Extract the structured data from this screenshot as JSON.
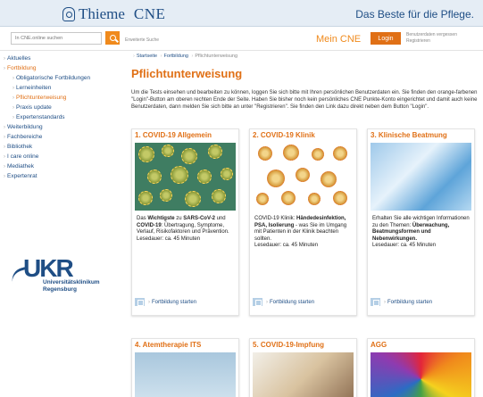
{
  "header": {
    "brand": "Thieme",
    "brand_suffix": "CNE",
    "slogan": "Das Beste für die Pflege."
  },
  "toolbar": {
    "search_placeholder": "In CNE.online suchen",
    "advanced_search": "Erweiterte Suche",
    "mein_cne": "Mein CNE",
    "login_label": "Login",
    "forgot_credentials": "Benutzerdaten vergessen",
    "register": "Registrieren"
  },
  "sidebar": {
    "items": [
      {
        "label": "Aktuelles"
      },
      {
        "label": "Fortbildung"
      },
      {
        "label": "Obligatorische Fortbildungen"
      },
      {
        "label": "Lerneinheiten"
      },
      {
        "label": "Pflichtunterweisung"
      },
      {
        "label": "Praxis update"
      },
      {
        "label": "Expertenstandards"
      },
      {
        "label": "Weiterbildung"
      },
      {
        "label": "Fachbereiche"
      },
      {
        "label": "Bibliothek"
      },
      {
        "label": "I care online"
      },
      {
        "label": "Mediathek"
      },
      {
        "label": "Expertenrat"
      }
    ],
    "logo_mark": "UKR",
    "logo_line1": "Universitätsklinikum",
    "logo_line2": "Regensburg"
  },
  "breadcrumb": [
    "Startseite",
    "Fortbildung",
    "Pflichtunterweisung"
  ],
  "page": {
    "title": "Pflichtunterweisung",
    "intro": "Um die Tests einsehen und bearbeiten zu können, loggen Sie sich bitte mit Ihren persönlichen Benutzerdaten ein. Sie finden den orange-farbenen \"Login\"-Button am oberen rechten Ende der Seite. Haben Sie bisher noch kein persönliches CNE Punkte-Konto eingerichtet und damit auch keine Benutzerdaten, dann melden Sie sich bitte an unter \"Registrieren\". Sie finden den Link dazu direkt neben dem Button \"Login\"."
  },
  "cards": [
    {
      "title": "1. COVID-19 Allgemein",
      "text_pre": "Das ",
      "text_b1": "Wichtigste",
      "text_mid1": " zu ",
      "text_b2": "SARS-CoV-2",
      "text_mid2": " und ",
      "text_b3": "COVID-19",
      "text_post": ": Übertragung, Symptome, Verlauf, Risikofaktoren und Prävention.",
      "duration": "Lesedauer: ca. 45 Minuten",
      "action": "Fortbildung starten"
    },
    {
      "title": "2. COVID-19 Klinik",
      "text_pre": "COVID-19 Klinik: ",
      "text_b1": "Händedesinfektion, PSA, Isolierung",
      "text_post": " - was Sie im Umgang mit Patienten in der Klinik beachten sollten.",
      "duration": "Lesedauer: ca. 45 Minuten",
      "action": "Fortbildung starten"
    },
    {
      "title": "3. Klinische Beatmung",
      "text_pre": "Erhalten Sie alle wichtigen Informationen zu den Themen: ",
      "text_b1": "Überwachung, Beatmungsformen und Nebenwirkungen.",
      "duration": "Lesedauer: ca. 45 Minuten",
      "action": "Fortbildung starten"
    },
    {
      "title": "4. Atemtherapie ITS"
    },
    {
      "title": "5. COVID-19-Impfung"
    },
    {
      "title": "AGG"
    }
  ]
}
